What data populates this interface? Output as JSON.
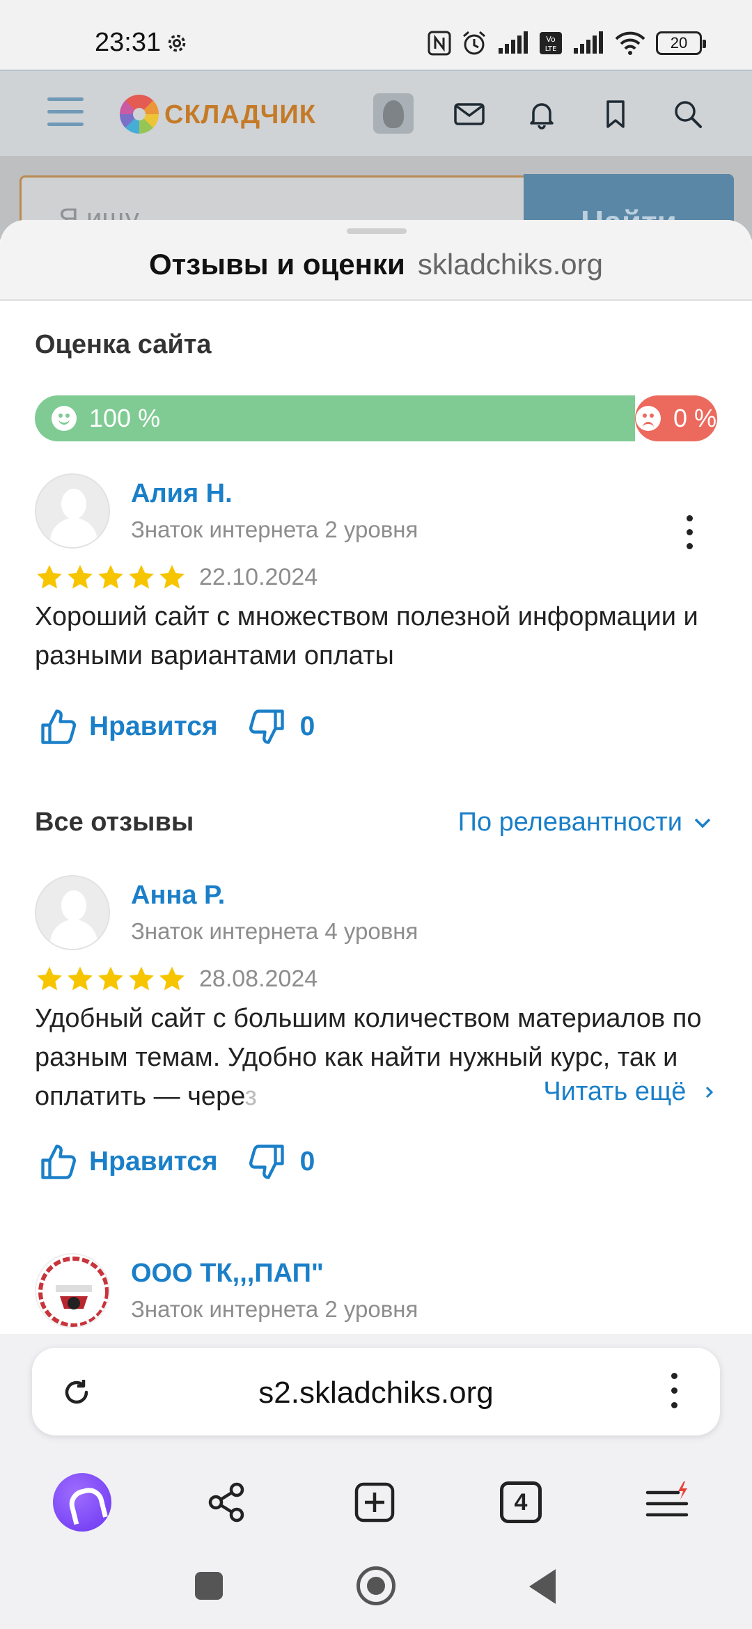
{
  "status_bar": {
    "time": "23:31",
    "battery": "20",
    "icons": [
      "gear-icon",
      "nfc-icon",
      "alarm-icon",
      "signal-icon",
      "volte-icon",
      "signal-icon",
      "wifi-icon",
      "battery-icon"
    ]
  },
  "site": {
    "logo_text": "СКЛАДЧИК",
    "search_placeholder": "Я ищу",
    "search_button": "Найти"
  },
  "sheet": {
    "title": "Отзывы и оценки",
    "domain": "skladchiks.org"
  },
  "site_rating": {
    "heading": "Оценка сайта",
    "positive": "100 %",
    "negative": "0 %",
    "positive_fraction": 1.0
  },
  "featured_review": {
    "name": "Алия Н.",
    "level": "Знаток интернета 2 уровня",
    "stars": 5,
    "date": "22.10.2024",
    "text": "Хороший сайт с множеством полезной информации и разными вариантами оплаты",
    "like_label": "Нравится",
    "dislike_count": "0"
  },
  "all_reviews": {
    "heading": "Все отзывы",
    "sort_label": "По релевантности"
  },
  "reviews": [
    {
      "name": "Анна Р.",
      "level": "Знаток интернета 4 уровня",
      "stars": 5,
      "date": "28.08.2024",
      "text_visible": "Удобный сайт с большим количеством материалов по разным темам. Удобно как найти нужный курс, так и оплатить — чере",
      "text_fade": "з",
      "read_more": "Читать ещё",
      "like_label": "Нравится",
      "dislike_count": "0"
    },
    {
      "name": "ООО ТК,,,ПАП\"",
      "level": "Знаток интернета 2 уровня"
    }
  ],
  "browser": {
    "url": "s2.skladchiks.org",
    "tabs_count": "4"
  },
  "colors": {
    "accent_blue": "#1a7fc8",
    "positive_green": "#7fcb93",
    "negative_red": "#ec6a5d",
    "star_yellow": "#f7c400"
  }
}
